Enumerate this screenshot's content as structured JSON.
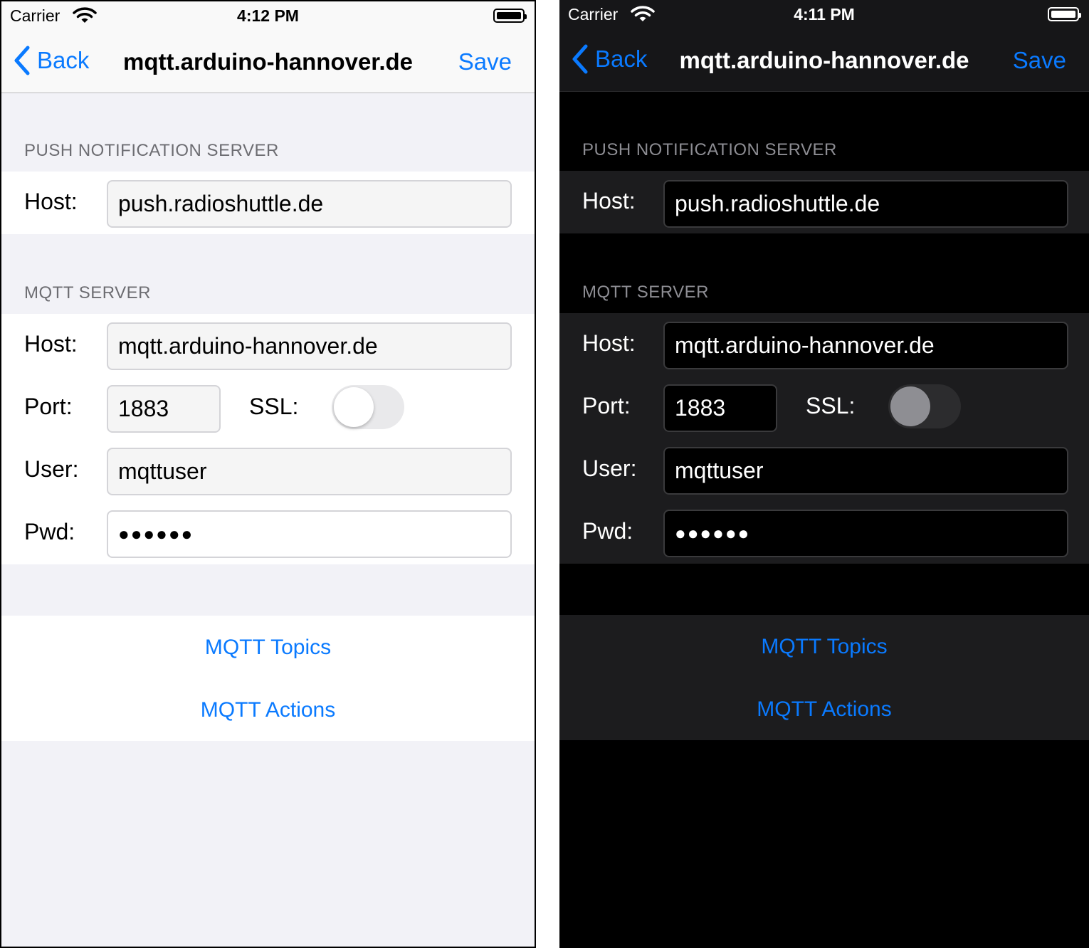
{
  "screens": [
    {
      "theme": "light",
      "status": {
        "carrier": "Carrier",
        "time": "4:12 PM"
      },
      "nav": {
        "back_label": "Back",
        "title": "mqtt.arduino-hannover.de",
        "save_label": "Save"
      },
      "push": {
        "header": "PUSH NOTIFICATION SERVER",
        "host_label": "Host:",
        "host_value": "push.radioshuttle.de"
      },
      "mqtt": {
        "header": "MQTT SERVER",
        "host_label": "Host:",
        "host_value": "mqtt.arduino-hannover.de",
        "port_label": "Port:",
        "port_value": "1883",
        "ssl_label": "SSL:",
        "ssl_on": false,
        "user_label": "User:",
        "user_value": "mqttuser",
        "pwd_label": "Pwd:",
        "pwd_value": "●●●●●●"
      },
      "links": {
        "topics": "MQTT Topics",
        "actions": "MQTT Actions"
      }
    },
    {
      "theme": "dark",
      "status": {
        "carrier": "Carrier",
        "time": "4:11 PM"
      },
      "nav": {
        "back_label": "Back",
        "title": "mqtt.arduino-hannover.de",
        "save_label": "Save"
      },
      "push": {
        "header": "PUSH NOTIFICATION SERVER",
        "host_label": "Host:",
        "host_value": "push.radioshuttle.de"
      },
      "mqtt": {
        "header": "MQTT SERVER",
        "host_label": "Host:",
        "host_value": "mqtt.arduino-hannover.de",
        "port_label": "Port:",
        "port_value": "1883",
        "ssl_label": "SSL:",
        "ssl_on": false,
        "user_label": "User:",
        "user_value": "mqttuser",
        "pwd_label": "Pwd:",
        "pwd_value": "●●●●●●"
      },
      "links": {
        "topics": "MQTT Topics",
        "actions": "MQTT Actions"
      }
    }
  ],
  "colors": {
    "accent": "#0a7aff",
    "light_bg": "#f2f2f7",
    "dark_bg": "#000000",
    "dark_group": "#1c1c1e"
  },
  "icons": {
    "back": "chevron-left-icon",
    "wifi": "wifi-icon",
    "battery": "battery-icon"
  }
}
